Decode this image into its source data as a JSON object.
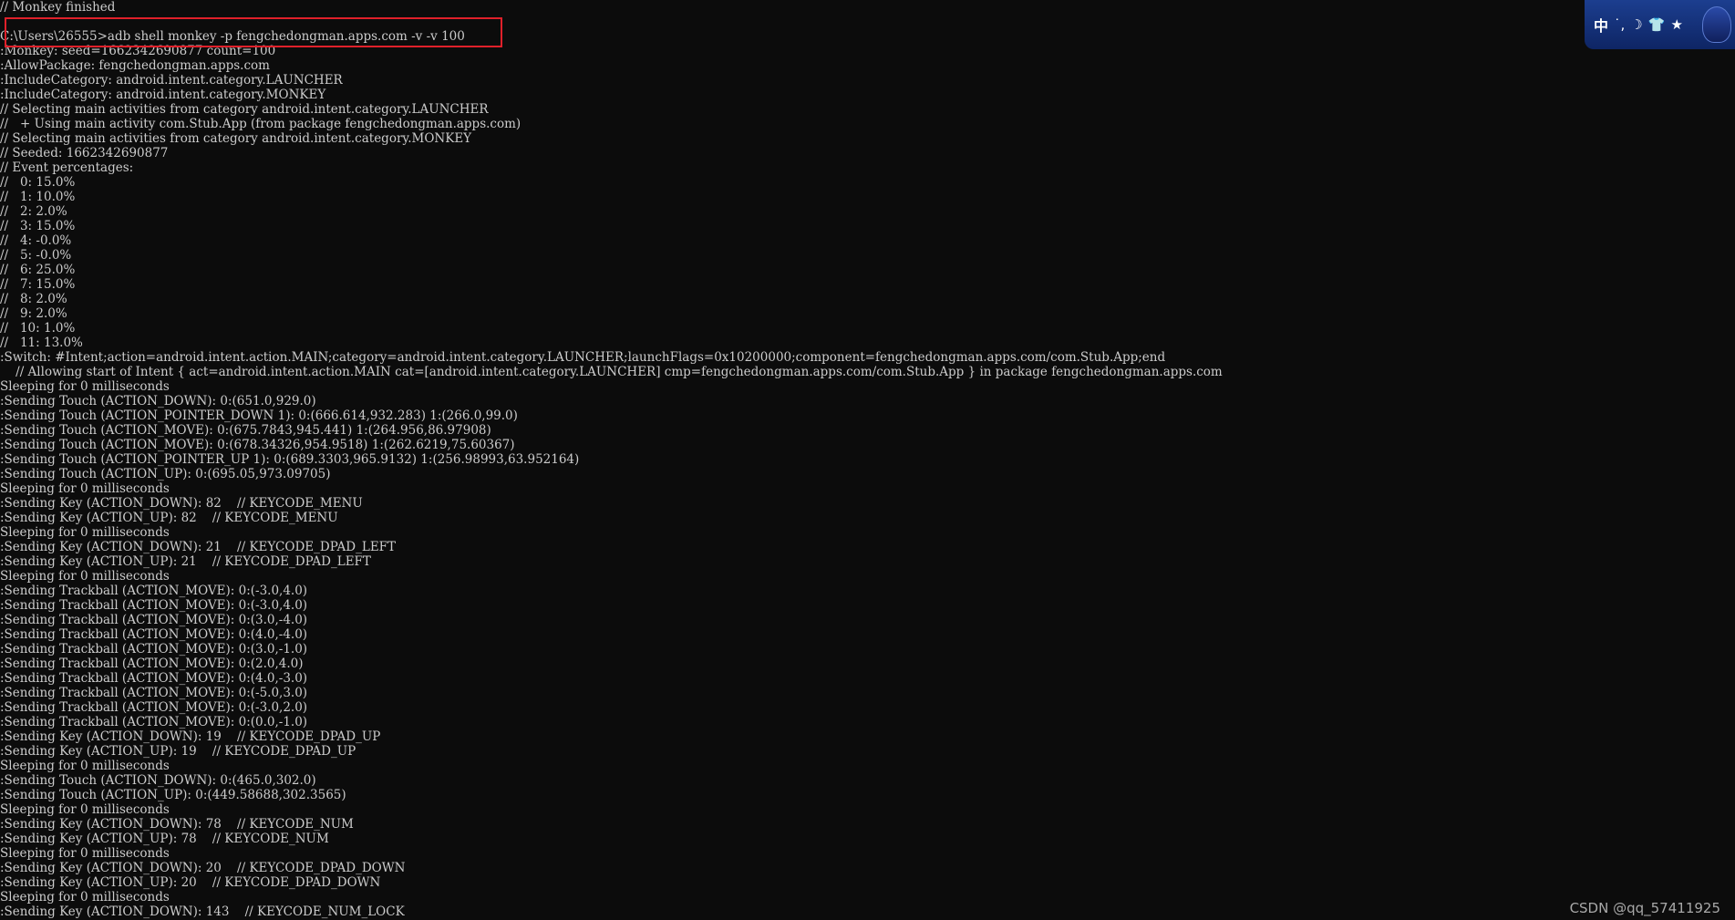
{
  "terminal": {
    "lines": [
      "// Monkey finished",
      "",
      "C:\\Users\\26555>adb shell monkey -p fengchedongman.apps.com -v -v 100",
      ":Monkey: seed=1662342690877 count=100",
      ":AllowPackage: fengchedongman.apps.com",
      ":IncludeCategory: android.intent.category.LAUNCHER",
      ":IncludeCategory: android.intent.category.MONKEY",
      "// Selecting main activities from category android.intent.category.LAUNCHER",
      "//   + Using main activity com.Stub.App (from package fengchedongman.apps.com)",
      "// Selecting main activities from category android.intent.category.MONKEY",
      "// Seeded: 1662342690877",
      "// Event percentages:",
      "//   0: 15.0%",
      "//   1: 10.0%",
      "//   2: 2.0%",
      "//   3: 15.0%",
      "//   4: -0.0%",
      "//   5: -0.0%",
      "//   6: 25.0%",
      "//   7: 15.0%",
      "//   8: 2.0%",
      "//   9: 2.0%",
      "//   10: 1.0%",
      "//   11: 13.0%",
      ":Switch: #Intent;action=android.intent.action.MAIN;category=android.intent.category.LAUNCHER;launchFlags=0x10200000;component=fengchedongman.apps.com/com.Stub.App;end",
      "    // Allowing start of Intent { act=android.intent.action.MAIN cat=[android.intent.category.LAUNCHER] cmp=fengchedongman.apps.com/com.Stub.App } in package fengchedongman.apps.com",
      "Sleeping for 0 milliseconds",
      ":Sending Touch (ACTION_DOWN): 0:(651.0,929.0)",
      ":Sending Touch (ACTION_POINTER_DOWN 1): 0:(666.614,932.283) 1:(266.0,99.0)",
      ":Sending Touch (ACTION_MOVE): 0:(675.7843,945.441) 1:(264.956,86.97908)",
      ":Sending Touch (ACTION_MOVE): 0:(678.34326,954.9518) 1:(262.6219,75.60367)",
      ":Sending Touch (ACTION_POINTER_UP 1): 0:(689.3303,965.9132) 1:(256.98993,63.952164)",
      ":Sending Touch (ACTION_UP): 0:(695.05,973.09705)",
      "Sleeping for 0 milliseconds",
      ":Sending Key (ACTION_DOWN): 82    // KEYCODE_MENU",
      ":Sending Key (ACTION_UP): 82    // KEYCODE_MENU",
      "Sleeping for 0 milliseconds",
      ":Sending Key (ACTION_DOWN): 21    // KEYCODE_DPAD_LEFT",
      ":Sending Key (ACTION_UP): 21    // KEYCODE_DPAD_LEFT",
      "Sleeping for 0 milliseconds",
      ":Sending Trackball (ACTION_MOVE): 0:(-3.0,4.0)",
      ":Sending Trackball (ACTION_MOVE): 0:(-3.0,4.0)",
      ":Sending Trackball (ACTION_MOVE): 0:(3.0,-4.0)",
      ":Sending Trackball (ACTION_MOVE): 0:(4.0,-4.0)",
      ":Sending Trackball (ACTION_MOVE): 0:(3.0,-1.0)",
      ":Sending Trackball (ACTION_MOVE): 0:(2.0,4.0)",
      ":Sending Trackball (ACTION_MOVE): 0:(4.0,-3.0)",
      ":Sending Trackball (ACTION_MOVE): 0:(-5.0,3.0)",
      ":Sending Trackball (ACTION_MOVE): 0:(-3.0,2.0)",
      ":Sending Trackball (ACTION_MOVE): 0:(0.0,-1.0)",
      ":Sending Key (ACTION_DOWN): 19    // KEYCODE_DPAD_UP",
      ":Sending Key (ACTION_UP): 19    // KEYCODE_DPAD_UP",
      "Sleeping for 0 milliseconds",
      ":Sending Touch (ACTION_DOWN): 0:(465.0,302.0)",
      ":Sending Touch (ACTION_UP): 0:(449.58688,302.3565)",
      "Sleeping for 0 milliseconds",
      ":Sending Key (ACTION_DOWN): 78    // KEYCODE_NUM",
      ":Sending Key (ACTION_UP): 78    // KEYCODE_NUM",
      "Sleeping for 0 milliseconds",
      ":Sending Key (ACTION_DOWN): 20    // KEYCODE_DPAD_DOWN",
      ":Sending Key (ACTION_UP): 20    // KEYCODE_DPAD_DOWN",
      "Sleeping for 0 milliseconds",
      ":Sending Key (ACTION_DOWN): 143    // KEYCODE_NUM_LOCK"
    ]
  },
  "ime_toolbar": {
    "language": "中",
    "icons": [
      "punctuation-icon",
      "moon-icon",
      "shirt-icon",
      "star-icon"
    ],
    "symbols": [
      "˙,",
      "☽",
      "👕",
      "★"
    ]
  },
  "watermark": {
    "text": "CSDN @qq_57411925"
  },
  "colors": {
    "background": "#0c0c0c",
    "text": "#cccccc",
    "highlight": "#e0202a",
    "ime_background": "#1c3e8f"
  }
}
